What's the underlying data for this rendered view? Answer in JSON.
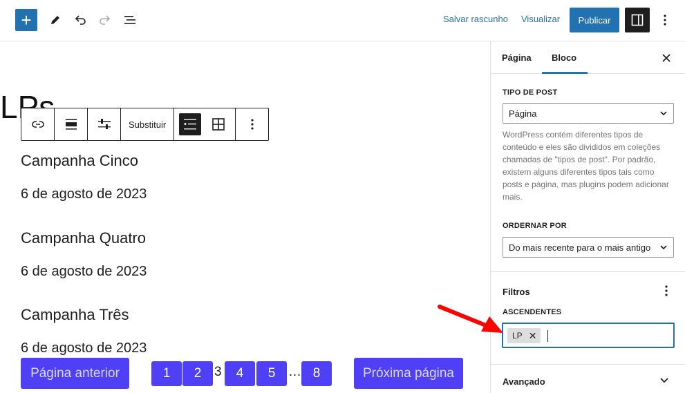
{
  "topbar": {
    "add_label": "+",
    "save_draft": "Salvar rascunho",
    "preview": "Visualizar",
    "publish": "Publicar"
  },
  "canvas": {
    "page_title": "LPs",
    "toolbar": {
      "replace": "Substituir"
    },
    "posts": [
      {
        "title": "Campanha Cinco",
        "date": "6 de agosto de 2023"
      },
      {
        "title": "Campanha Quatro",
        "date": "6 de agosto de 2023"
      },
      {
        "title": "Campanha Três",
        "date": "6 de agosto de 2023"
      }
    ],
    "pagination": {
      "previous": "Página anterior",
      "next": "Próxima página",
      "pages": [
        "1",
        "2",
        "3",
        "4",
        "5",
        "…",
        "8"
      ]
    }
  },
  "sidebar": {
    "tabs": [
      "Página",
      "Bloco"
    ],
    "active_tab": "Bloco",
    "post_type": {
      "label": "TIPO DE POST",
      "value": "Página",
      "help": "WordPress contém diferentes tipos de conteúdo e eles são divididos em coleções chamadas de \"tipos de post\". Por padrão, existem alguns diferentes tipos tais como posts e página, mas plugins podem adicionar mais."
    },
    "order": {
      "label": "ORDERNAR POR",
      "value": "Do mais recente para o mais antigo"
    },
    "filters": {
      "heading": "Filtros",
      "parents_label": "ASCENDENTES",
      "tokens": [
        "LP"
      ]
    },
    "advanced": "Avançado"
  },
  "colors": {
    "accent": "#2271b1",
    "pagination": "#4f40f5",
    "arrow": "#ff0000"
  }
}
